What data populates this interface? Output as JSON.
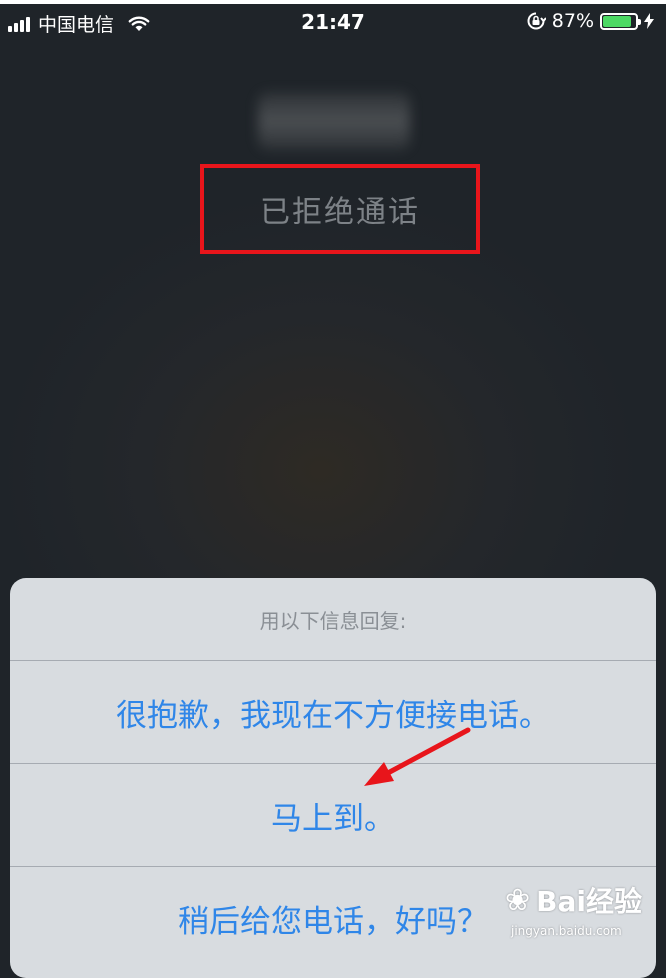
{
  "status_bar": {
    "carrier": "中国电信",
    "time": "21:47",
    "battery_percent": "87%",
    "battery_level": 0.87,
    "icons": [
      "signal-icon",
      "wifi-icon",
      "orientation-lock-icon",
      "battery-icon",
      "charging-bolt-icon"
    ]
  },
  "call": {
    "status": "已拒绝通话"
  },
  "reply_sheet": {
    "header": "用以下信息回复:",
    "options": [
      "很抱歉，我现在不方便接电话。",
      "马上到。",
      "稍后给您电话，好吗？"
    ]
  },
  "annotation": {
    "arrow_color": "#e8151b",
    "box_color": "#e8151b"
  },
  "watermark": {
    "logo": "Bai经验",
    "url": "jingyan.baidu.com"
  }
}
